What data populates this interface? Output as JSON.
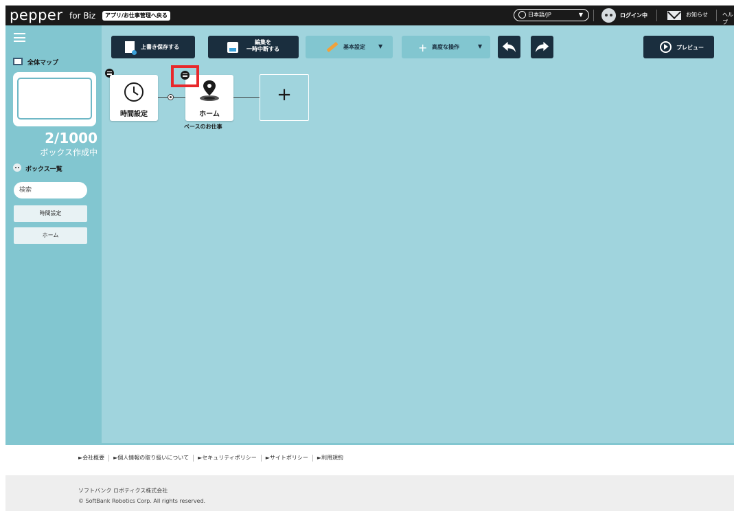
{
  "topbar": {
    "logo": "pepper",
    "logo_sub": "for Biz",
    "back_button": "アプリ/お仕事管理へ戻る",
    "language": "日本語/JP",
    "login_status": "ログイン中",
    "news": "お知らせ",
    "help": "ヘルプ"
  },
  "sidebar": {
    "map_title": "全体マップ",
    "count": "2/1000",
    "count_label": "ボックス作成中",
    "box_list_title": "ボックス一覧",
    "search_placeholder": "検索",
    "items": [
      {
        "label": "時間設定"
      },
      {
        "label": "ホーム"
      }
    ]
  },
  "toolbar": {
    "save_label": "上書き保存する",
    "suspend_label_1": "編集を",
    "suspend_label_2": "一時中断する",
    "basic_settings_label": "基本設定",
    "advanced_label": "高度な操作",
    "preview_label": "プレビュー"
  },
  "flow": {
    "nodes": [
      {
        "label": "時間設定",
        "icon": "clock-icon"
      },
      {
        "label": "ホーム",
        "icon": "location-pin-icon",
        "caption": "ベースのお仕事"
      }
    ],
    "add_label": "+"
  },
  "footer": {
    "links": [
      "►会社概要",
      "►個人情報の取り扱いについて",
      "►セキュリティポリシー",
      "►サイトポリシー",
      "►利用規約"
    ],
    "company": "ソフトバンク ロボティクス株式会社",
    "copyright": "© SoftBank Robotics Corp. All rights reserved."
  },
  "colors": {
    "topbar": "#1a1a1a",
    "sidebar": "#82c6d0",
    "canvas": "#a0d4dd",
    "button_dark": "#1a2e3e",
    "highlight": "#e8282b"
  }
}
